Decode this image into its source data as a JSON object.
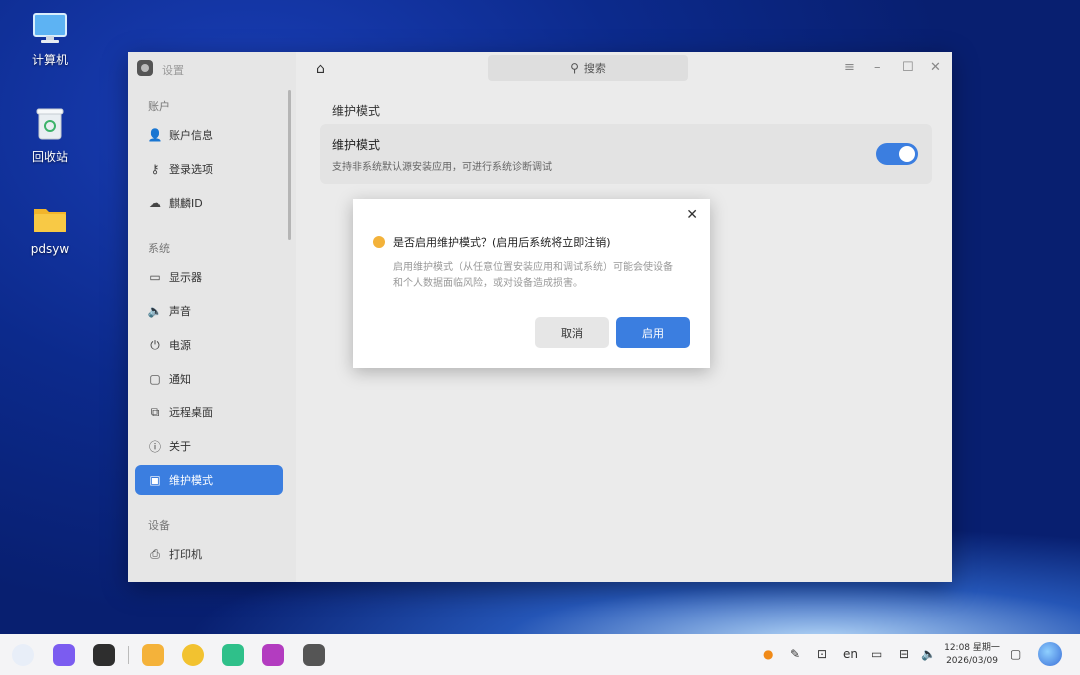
{
  "desktop": {
    "icons": [
      {
        "label": "计算机",
        "icon": "computer-icon"
      },
      {
        "label": "回收站",
        "icon": "trash-icon"
      },
      {
        "label": "pdsyw",
        "icon": "folder-icon"
      }
    ]
  },
  "window": {
    "app_title": "设置",
    "search_placeholder": "搜索",
    "sidebar": {
      "sections": [
        {
          "title": "账户",
          "items": [
            {
              "label": "账户信息",
              "icon": "user-icon"
            },
            {
              "label": "登录选项",
              "icon": "key-icon"
            },
            {
              "label": "麒麟ID",
              "icon": "cloud-icon"
            }
          ]
        },
        {
          "title": "系统",
          "items": [
            {
              "label": "显示器",
              "icon": "monitor-icon"
            },
            {
              "label": "声音",
              "icon": "speaker-icon"
            },
            {
              "label": "电源",
              "icon": "power-icon"
            },
            {
              "label": "通知",
              "icon": "notification-icon"
            },
            {
              "label": "远程桌面",
              "icon": "remote-desktop-icon"
            },
            {
              "label": "关于",
              "icon": "info-icon"
            },
            {
              "label": "维护模式",
              "icon": "maintenance-icon",
              "active": true
            }
          ]
        },
        {
          "title": "设备",
          "items": [
            {
              "label": "打印机",
              "icon": "printer-icon"
            }
          ]
        }
      ]
    },
    "main": {
      "page_title": "维护模式",
      "card": {
        "title": "维护模式",
        "description": "支持非系统默认源安装应用，可进行系统诊断调试",
        "toggle_on": true
      }
    }
  },
  "dialog": {
    "title": "是否启用维护模式？(启用后系统将立即注销)",
    "body": "启用维护模式（从任意位置安装应用和调试系统）可能会使设备和个人数据面临风险，或对设备造成损害。",
    "cancel_label": "取消",
    "confirm_label": "启用"
  },
  "taskbar": {
    "tray_lang": "en",
    "time": "12:08 星期一",
    "date": "2026/03/09"
  },
  "colors": {
    "accent": "#3b7ee0",
    "warning": "#f3b23a"
  }
}
